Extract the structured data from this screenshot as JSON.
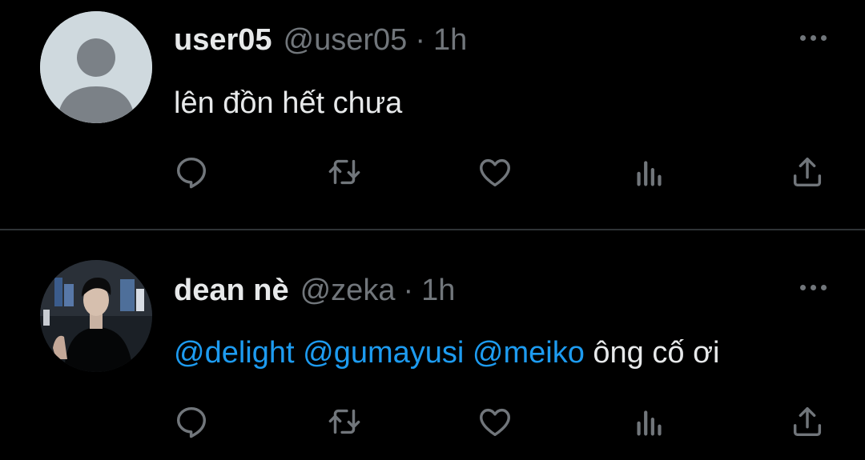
{
  "tweets": [
    {
      "display_name": "user05",
      "handle": "@user05",
      "separator": "·",
      "time": "1h",
      "text": "lên đồn hết chưa"
    },
    {
      "display_name": "dean nè",
      "handle": "@zeka",
      "separator": "·",
      "time": "1h",
      "mentions": [
        "@delight",
        "@gumayusi",
        "@meiko"
      ],
      "text_after_mentions": " ông cố ơi"
    }
  ],
  "colors": {
    "background": "#000000",
    "text": "#e7e9ea",
    "muted": "#71767b",
    "link": "#1d9bf0",
    "divider": "#2f3336",
    "default_avatar": "#cfd9de"
  },
  "icons": [
    "reply-icon",
    "retweet-icon",
    "like-icon",
    "views-icon",
    "share-icon",
    "more-icon"
  ]
}
